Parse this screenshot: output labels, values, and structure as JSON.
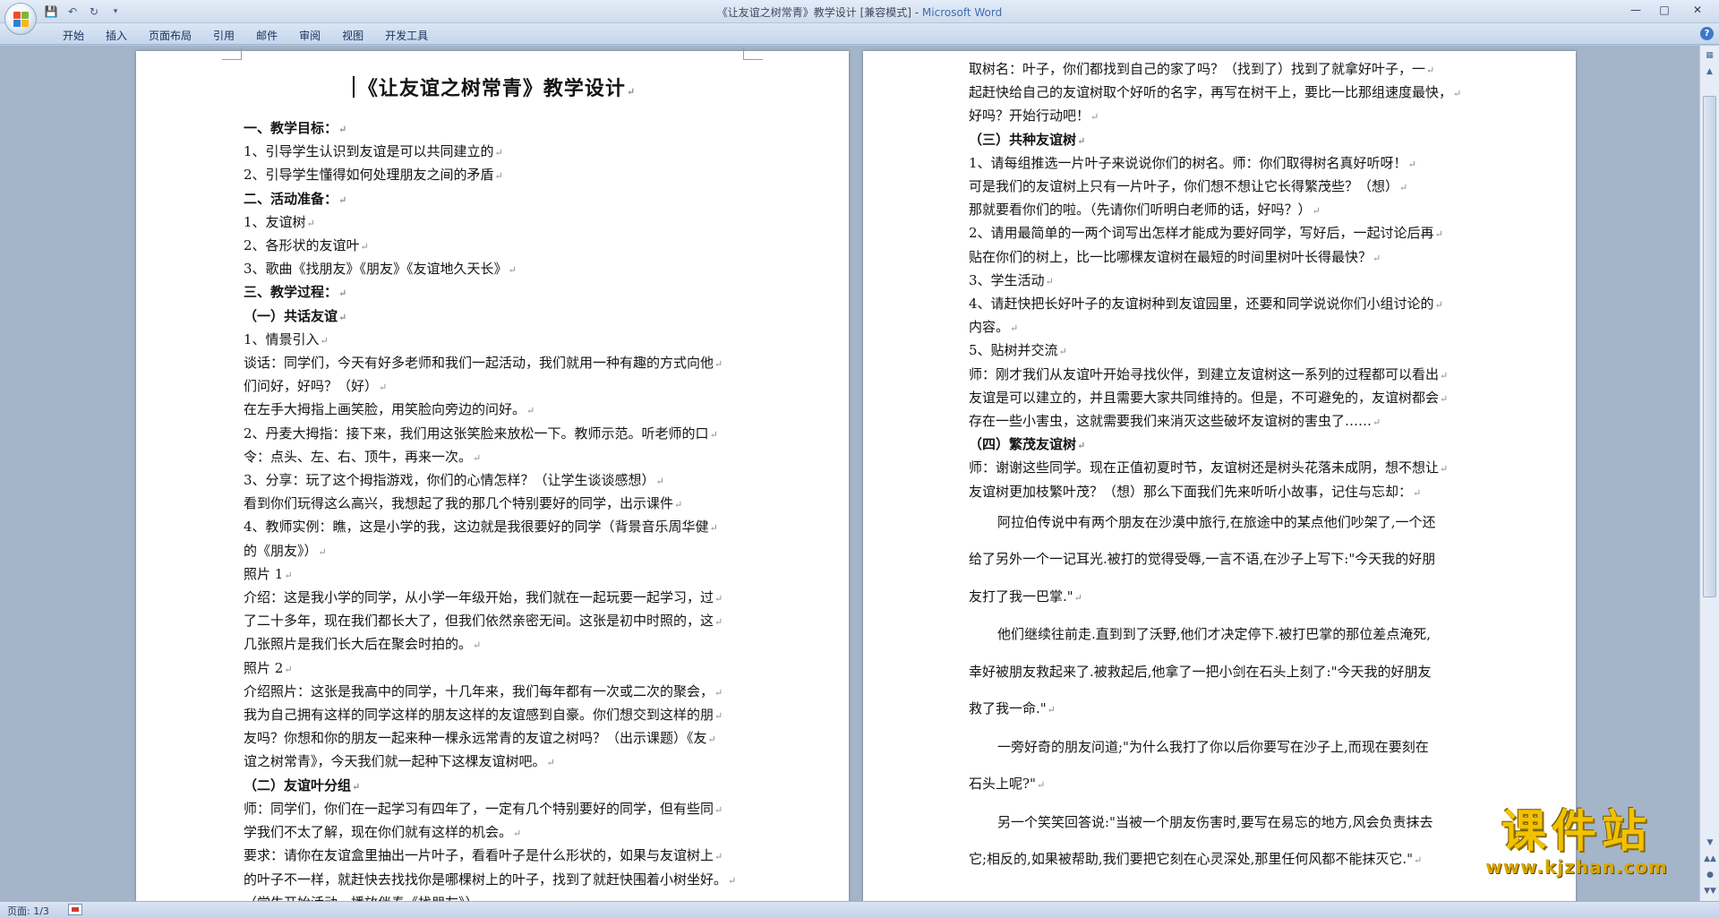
{
  "window": {
    "title_doc": "《让友谊之树常青》教学设计 [兼容模式] - ",
    "title_app": "Microsoft Word"
  },
  "quick_access": {
    "icons": [
      "save-icon",
      "undo-icon",
      "redo-icon",
      "customize-icon"
    ]
  },
  "ribbon": {
    "tabs": [
      "开始",
      "插入",
      "页面布局",
      "引用",
      "邮件",
      "审阅",
      "视图",
      "开发工具"
    ]
  },
  "page1": {
    "title": "《让友谊之树常青》教学设计",
    "lines": [
      {
        "text": "一、教学目标：",
        "bold": true
      },
      {
        "text": "1、引导学生认识到友谊是可以共同建立的",
        "bold": false
      },
      {
        "text": "2、引导学生懂得如何处理朋友之间的矛盾",
        "bold": false
      },
      {
        "text": "二、活动准备：",
        "bold": true
      },
      {
        "text": "1、友谊树",
        "bold": false
      },
      {
        "text": "2、各形状的友谊叶",
        "bold": false
      },
      {
        "text": "3、歌曲《找朋友》《朋友》《友谊地久天长》",
        "bold": false
      },
      {
        "text": "三、教学过程：",
        "bold": true
      },
      {
        "text": "（一）共话友谊",
        "bold": true
      },
      {
        "text": "1、情景引入",
        "bold": false
      },
      {
        "text": "谈话：同学们，今天有好多老师和我们一起活动，我们就用一种有趣的方式向他",
        "bold": false
      },
      {
        "text": "们问好，好吗？（好）",
        "bold": false
      },
      {
        "text": "在左手大拇指上画笑脸，用笑脸向旁边的问好。",
        "bold": false
      },
      {
        "text": "2、丹麦大拇指：接下来，我们用这张笑脸来放松一下。教师示范。听老师的口",
        "bold": false
      },
      {
        "text": "令：点头、左、右、顶牛，再来一次。",
        "bold": false
      },
      {
        "text": "3、分享：玩了这个拇指游戏，你们的心情怎样？（让学生谈谈感想）",
        "bold": false
      },
      {
        "text": "看到你们玩得这么高兴，我想起了我的那几个特别要好的同学，出示课件",
        "bold": false
      },
      {
        "text": "4、教师实例：瞧，这是小学的我，这边就是我很要好的同学（背景音乐周华健",
        "bold": false
      },
      {
        "text": "的《朋友》）",
        "bold": false
      },
      {
        "text": "照片 1",
        "bold": false
      },
      {
        "text": "介绍：这是我小学的同学，从小学一年级开始，我们就在一起玩要一起学习，过",
        "bold": false
      },
      {
        "text": "了二十多年，现在我们都长大了，但我们依然亲密无间。这张是初中时照的，这",
        "bold": false
      },
      {
        "text": "几张照片是我们长大后在聚会时拍的。",
        "bold": false
      },
      {
        "text": "照片 2",
        "bold": false
      },
      {
        "text": "介绍照片：这张是我高中的同学，十几年来，我们每年都有一次或二次的聚会，",
        "bold": false
      },
      {
        "text": "我为自己拥有这样的同学这样的朋友这样的友谊感到自豪。你们想交到这样的朋",
        "bold": false
      },
      {
        "text": "友吗？你想和你的朋友一起来种一棵永远常青的友谊之树吗？（出示课题）《友",
        "bold": false
      },
      {
        "text": "谊之树常青》，今天我们就一起种下这棵友谊树吧。",
        "bold": false
      },
      {
        "text": "（二）友谊叶分组",
        "bold": true
      },
      {
        "text": "师：同学们，你们在一起学习有四年了，一定有几个特别要好的同学，但有些同",
        "bold": false
      },
      {
        "text": "学我们不太了解，现在你们就有这样的机会。",
        "bold": false
      },
      {
        "text": "要求：请你在友谊盒里抽出一片叶子，看看叶子是什么形状的，如果与友谊树上",
        "bold": false
      },
      {
        "text": "的叶子不一样，就赶快去找找你是哪棵树上的叶子，找到了就赶快围着小树坐好。",
        "bold": false
      },
      {
        "text": "（学生开始活动，播放伴奏《找朋友》）",
        "bold": false
      }
    ]
  },
  "page2": {
    "lines": [
      {
        "text": "取树名：叶子，你们都找到自己的家了吗？（找到了）找到了就拿好叶子，一",
        "bold": false
      },
      {
        "text": "起赶快给自己的友谊树取个好听的名字，再写在树干上，要比一比那组速度最快，",
        "bold": false
      },
      {
        "text": "好吗？开始行动吧！",
        "bold": false
      },
      {
        "text": "（三）共种友谊树",
        "bold": true
      },
      {
        "text": "1、请每组推选一片叶子来说说你们的树名。师：你们取得树名真好听呀！",
        "bold": false
      },
      {
        "text": "可是我们的友谊树上只有一片叶子，你们想不想让它长得繁茂些？（想）",
        "bold": false
      },
      {
        "text": "那就要看你们的啦。（先请你们听明白老师的话，好吗？）",
        "bold": false
      },
      {
        "text": "2、请用最简单的一两个词写出怎样才能成为要好同学，写好后，一起讨论后再",
        "bold": false
      },
      {
        "text": "贴在你们的树上，比一比哪棵友谊树在最短的时间里树叶长得最快？",
        "bold": false
      },
      {
        "text": "3、学生活动",
        "bold": false
      },
      {
        "text": "4、请赶快把长好叶子的友谊树种到友谊园里，还要和同学说说你们小组讨论的",
        "bold": false
      },
      {
        "text": "内容。",
        "bold": false
      },
      {
        "text": "5、贴树并交流",
        "bold": false
      },
      {
        "text": "师：刚才我们从友谊叶开始寻找伙伴，到建立友谊树这一系列的过程都可以看出",
        "bold": false
      },
      {
        "text": "友谊是可以建立的，并且需要大家共同维持的。但是，不可避免的，友谊树都会",
        "bold": false
      },
      {
        "text": "存在一些小害虫，这就需要我们来消灭这些破坏友谊树的害虫了……",
        "bold": false
      },
      {
        "text": "（四）繁茂友谊树",
        "bold": true
      },
      {
        "text": "师：谢谢这些同学。现在正值初夏时节，友谊树还是树头花落未成阴，想不想让",
        "bold": false
      },
      {
        "text": "友谊树更加枝繁叶茂？（想）那么下面我们先来听听小故事，记住与忘却：",
        "bold": false
      }
    ],
    "story": [
      {
        "text": "阿拉伯传说中有两个朋友在沙漠中旅行,在旅途中的某点他们吵架了,一个还",
        "indent": true
      },
      {
        "text": "给了另外一个一记耳光.被打的觉得受辱,一言不语,在沙子上写下:\"今天我的好朋",
        "indent": false
      },
      {
        "text": "友打了我一巴掌.\"",
        "indent": false
      },
      {
        "text": "他们继续往前走.直到到了沃野,他们才决定停下.被打巴掌的那位差点淹死,",
        "indent": true
      },
      {
        "text": "幸好被朋友救起来了.被救起后,他拿了一把小剑在石头上刻了:\"今天我的好朋友",
        "indent": false
      },
      {
        "text": "救了我一命.\"",
        "indent": false
      },
      {
        "text": "一旁好奇的朋友问道;\"为什么我打了你以后你要写在沙子上,而现在要刻在",
        "indent": true
      },
      {
        "text": "石头上呢?\"",
        "indent": false
      },
      {
        "text": "另一个笑笑回答说:\"当被一个朋友伤害时,要写在易忘的地方,风会负责抹去",
        "indent": true
      },
      {
        "text": "它;相反的,如果被帮助,我们要把它刻在心灵深处,那里任何风都不能抹灭它.\"",
        "indent": false
      }
    ]
  },
  "status": {
    "page_count": "页面: 1/3"
  },
  "watermark": {
    "cn": "课件站",
    "url": "www.kjzhan.com"
  },
  "colors": {
    "accent": "#3f6cb0",
    "workspace": "#a4b4c9",
    "watermark": "#f2c100"
  }
}
